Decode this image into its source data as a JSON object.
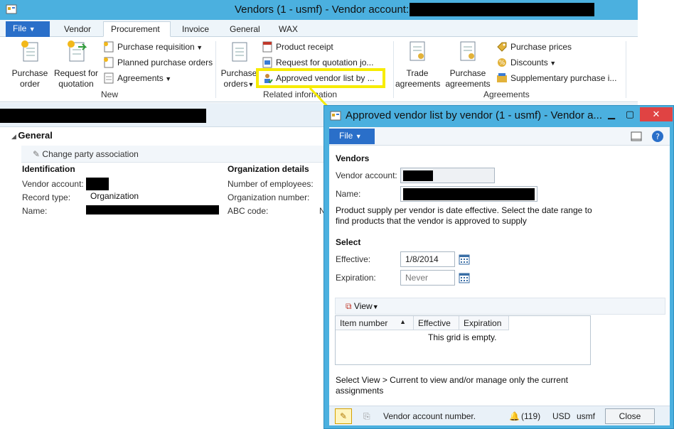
{
  "main_window": {
    "title": "Vendors (1 - usmf) - Vendor account:",
    "tabs": [
      "File",
      "Vendor",
      "Procurement",
      "Invoice",
      "General",
      "WAX"
    ],
    "active_tab": "Procurement",
    "ribbon": {
      "new_group": {
        "label": "New",
        "purchase_order": [
          "Purchase",
          "order"
        ],
        "request_for_quotation": [
          "Request for",
          "quotation"
        ],
        "purchase_requisition": "Purchase requisition",
        "planned_purchase_orders": "Planned purchase orders",
        "agreements": "Agreements"
      },
      "related_group": {
        "label": "Related information",
        "purchase_orders": [
          "Purchase",
          "orders"
        ],
        "product_receipt": "Product receipt",
        "rfq_journal": "Request for quotation jo...",
        "approved_vendor_list": "Approved vendor list by ..."
      },
      "agreements_group": {
        "label": "Agreements",
        "trade_agreements": [
          "Trade",
          "agreements"
        ],
        "purchase_agreements": [
          "Purchase",
          "agreements"
        ],
        "purchase_prices": "Purchase prices",
        "discounts": "Discounts",
        "supplementary": "Supplementary purchase i..."
      }
    },
    "general": {
      "header": "General",
      "change_party": "Change party association",
      "identification": "Identification",
      "vendor_account_label": "Vendor account:",
      "record_type_label": "Record type:",
      "record_type_value": "Organization",
      "name_label": "Name:",
      "org_details": "Organization details",
      "employees_label": "Number of employees:",
      "org_number_label": "Organization number:",
      "abc_label": "ABC code:",
      "abc_value_fragment": "N"
    }
  },
  "dialog": {
    "title": "Approved vendor list by vendor (1 - usmf) - Vendor a...",
    "file_tab": "File",
    "vendors_header": "Vendors",
    "vendor_account_label": "Vendor account:",
    "name_label": "Name:",
    "info_text_1": "Product supply per vendor is date effective. Select the date range to",
    "info_text_2": "find products that the vendor is approved to supply",
    "select_header": "Select",
    "effective_label": "Effective:",
    "effective_value": "1/8/2014",
    "expiration_label": "Expiration:",
    "expiration_value": "Never",
    "view_button": "View",
    "grid_columns": [
      "Item number",
      "Effective",
      "Expiration"
    ],
    "grid_empty": "This grid is empty.",
    "help_text_1": "Select View > Current to view and/or manage only the current",
    "help_text_2": "assignments",
    "status": {
      "field_text": "Vendor account number.",
      "notifications": "(119)",
      "currency": "USD",
      "company": "usmf",
      "close": "Close"
    }
  },
  "colors": {
    "title_bar": "#4bb0df",
    "file_tab": "#2a6fc9",
    "highlight": "#f7ec00",
    "close_x": "#e04343"
  }
}
